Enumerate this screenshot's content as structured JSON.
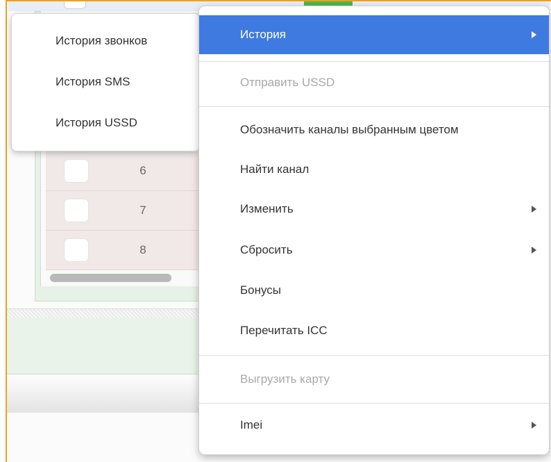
{
  "colors": {
    "accent": "#3f7ae0",
    "disabled_text": "#a8a8a8",
    "frame_border": "#f0a01e"
  },
  "background_table": {
    "rows": [
      "6",
      "7",
      "8"
    ]
  },
  "submenu": {
    "items": [
      "История звонков",
      "История SMS",
      "История USSD"
    ]
  },
  "menu": {
    "items": [
      {
        "label": "История",
        "state": "highlighted",
        "has_submenu": true
      },
      {
        "label": "Отправить USSD",
        "state": "disabled",
        "has_submenu": false
      },
      {
        "label": "Обозначить каналы выбранным цветом",
        "state": "enabled",
        "has_submenu": false
      },
      {
        "label": "Найти канал",
        "state": "enabled",
        "has_submenu": false
      },
      {
        "label": "Изменить",
        "state": "enabled",
        "has_submenu": true
      },
      {
        "label": "Сбросить",
        "state": "enabled",
        "has_submenu": true
      },
      {
        "label": "Бонусы",
        "state": "enabled",
        "has_submenu": false
      },
      {
        "label": "Перечитать ICC",
        "state": "enabled",
        "has_submenu": false
      },
      {
        "label": "Выгрузить карту",
        "state": "disabled",
        "has_submenu": false
      },
      {
        "label": "Imei",
        "state": "enabled",
        "has_submenu": true
      }
    ]
  },
  "icons": {
    "submenu_arrow": "chevron-right-icon"
  }
}
